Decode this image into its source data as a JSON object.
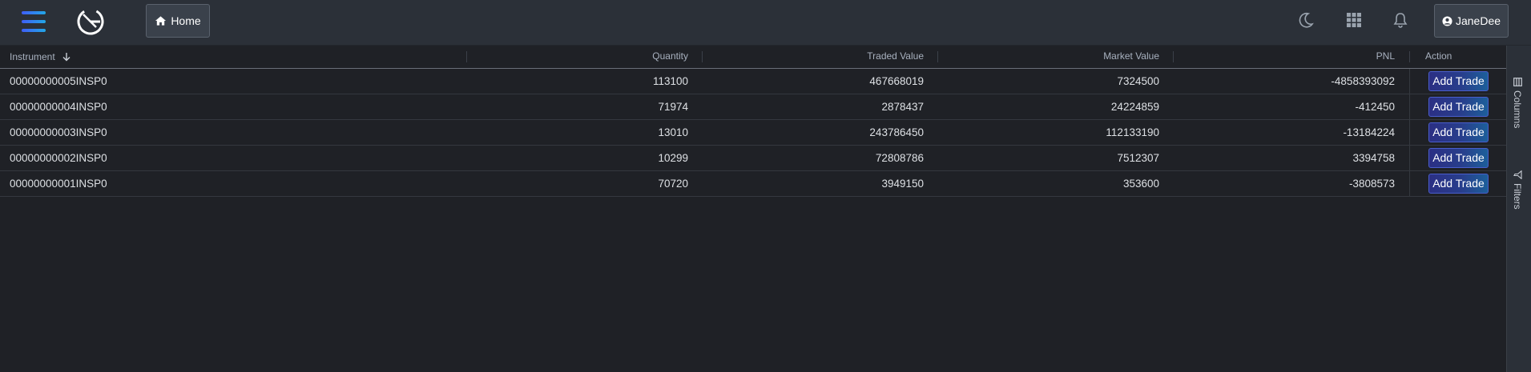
{
  "header": {
    "home_label": "Home",
    "user_label": "JaneDee",
    "menu_icon": "hamburger-menu-icon",
    "logo": "brand-logo",
    "theme_icon": "moon-icon",
    "apps_icon": "grid-apps-icon",
    "notify_icon": "bell-icon"
  },
  "grid": {
    "columns": [
      "Instrument",
      "Quantity",
      "Traded Value",
      "Market Value",
      "PNL",
      "Action"
    ],
    "sort": {
      "column": "Instrument",
      "direction": "descending"
    },
    "rows": [
      {
        "instrument": "00000000005INSP0",
        "quantity": "113100",
        "traded_value": "467668019",
        "market_value": "7324500",
        "pnl": "-4858393092",
        "action": "Add Trade"
      },
      {
        "instrument": "00000000004INSP0",
        "quantity": "71974",
        "traded_value": "2878437",
        "market_value": "24224859",
        "pnl": "-412450",
        "action": "Add Trade"
      },
      {
        "instrument": "00000000003INSP0",
        "quantity": "13010",
        "traded_value": "243786450",
        "market_value": "112133190",
        "pnl": "-13184224",
        "action": "Add Trade"
      },
      {
        "instrument": "00000000002INSP0",
        "quantity": "10299",
        "traded_value": "72808786",
        "market_value": "7512307",
        "pnl": "3394758",
        "action": "Add Trade"
      },
      {
        "instrument": "00000000001INSP0",
        "quantity": "70720",
        "traded_value": "3949150",
        "market_value": "353600",
        "pnl": "-3808573",
        "action": "Add Trade"
      }
    ]
  },
  "side_panel": {
    "columns_label": "Columns",
    "filters_label": "Filters"
  },
  "colors": {
    "background": "#1f2126",
    "topbar": "#2b3038",
    "accent_start": "#3f5ef7",
    "accent_end": "#22a7e6",
    "button_gradient_start": "#2b2f84",
    "button_gradient_end": "#1d5f9a"
  }
}
